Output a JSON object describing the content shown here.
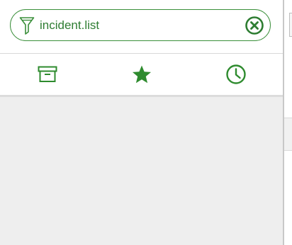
{
  "filter": {
    "value": "incident.list",
    "icon": "filter-icon",
    "clear_icon": "clear-circle-x-icon"
  },
  "tabs": [
    {
      "name": "archived",
      "icon": "archive-box-icon"
    },
    {
      "name": "favorites",
      "icon": "star-icon",
      "active": true
    },
    {
      "name": "history",
      "icon": "clock-icon"
    }
  ],
  "colors": {
    "accent": "#2e8b2e",
    "accent_dark": "#2e7d32",
    "panel_bg": "#eeeeee",
    "border": "#d9d9d9"
  }
}
